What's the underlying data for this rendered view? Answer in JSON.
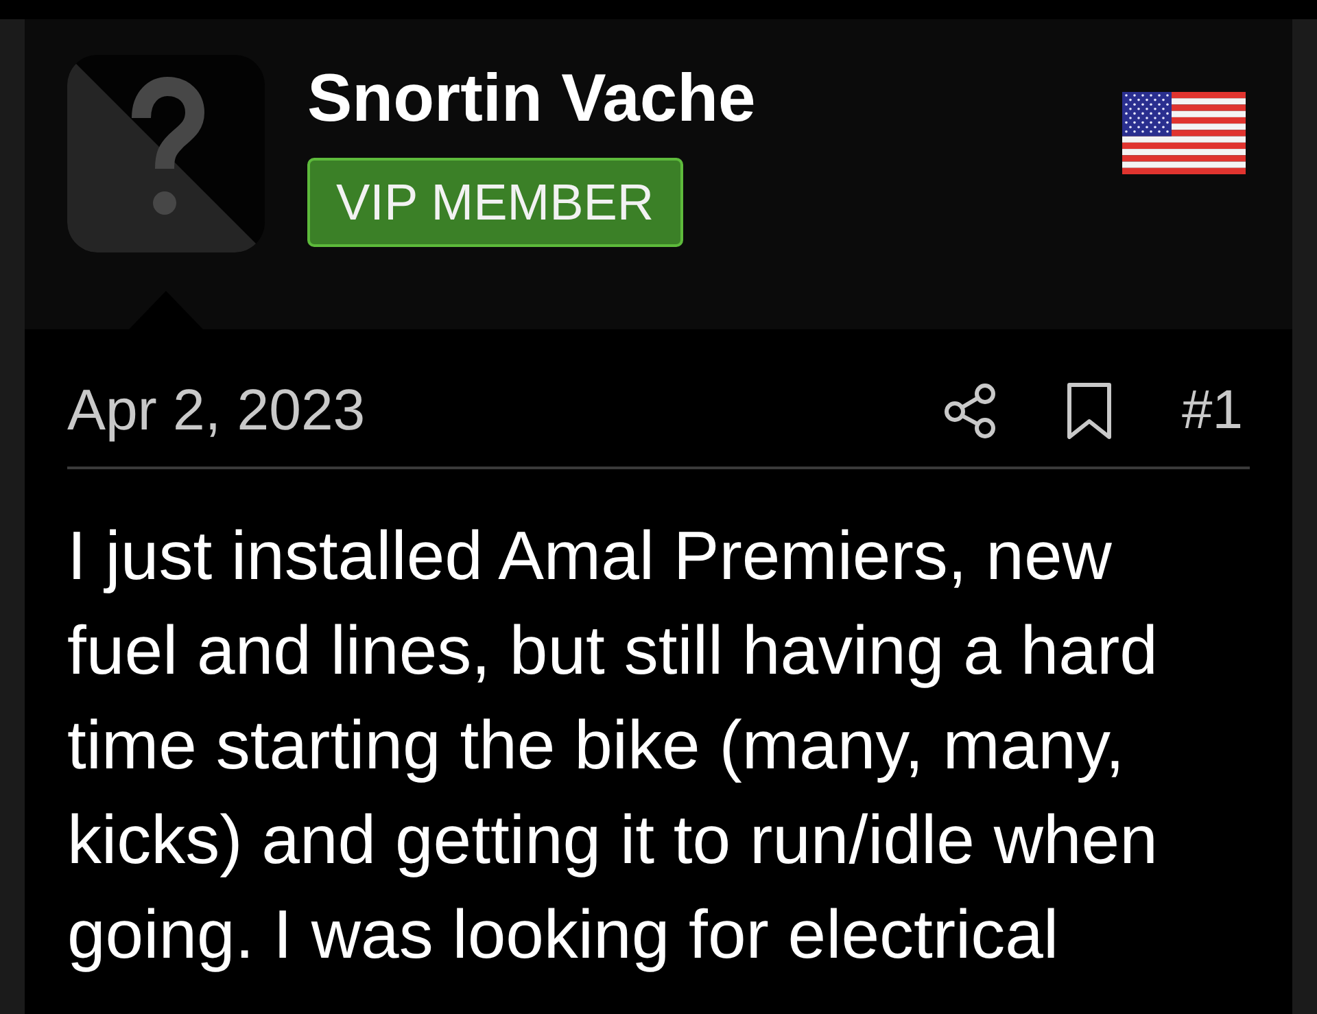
{
  "post": {
    "author": {
      "name": "Snortin Vache",
      "badge": "VIP MEMBER"
    },
    "date": "Apr 2, 2023",
    "number": "#1",
    "body_lines": [
      "I just installed Amal Premiers, new",
      "fuel and lines, but still having a hard",
      "time starting the bike (many, many,",
      "kicks) and getting it to run/idle when",
      "going. I was looking for electrical"
    ]
  }
}
